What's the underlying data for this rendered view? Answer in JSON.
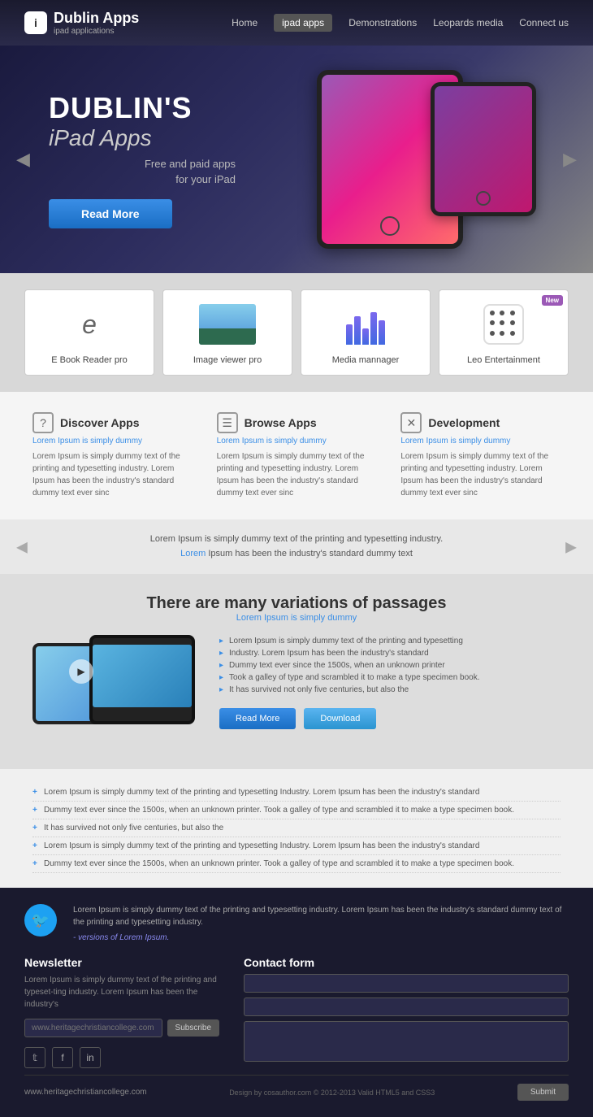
{
  "header": {
    "logo_icon": "i",
    "logo_title": "Dublin Apps",
    "logo_sub": "ipad applications",
    "nav": [
      {
        "label": "Home",
        "active": false
      },
      {
        "label": "ipad apps",
        "active": true
      },
      {
        "label": "Demonstrations",
        "active": false
      },
      {
        "label": "Leopards media",
        "active": false
      },
      {
        "label": "Connect us",
        "active": false
      }
    ]
  },
  "hero": {
    "title_big": "DUBLIN'S",
    "title_sub": "iPad Apps",
    "desc_line1": "Free and paid apps",
    "desc_line2": "for your iPad",
    "btn_label": "Read More",
    "arrow_left": "◀",
    "arrow_right": "▶"
  },
  "apps": [
    {
      "label": "E Book Reader pro",
      "icon_type": "letter"
    },
    {
      "label": "Image viewer pro",
      "icon_type": "landscape"
    },
    {
      "label": "Media mannager",
      "icon_type": "bars"
    },
    {
      "label": "Leo Entertainment",
      "icon_type": "dice",
      "badge": "New"
    }
  ],
  "features": [
    {
      "icon": "?",
      "title": "Discover Apps",
      "sub": "Lorem Ipsum is simply dummy",
      "text": "Lorem Ipsum is simply dummy text of the printing and typesetting industry. Lorem Ipsum has been the industry's standard dummy text ever sinc"
    },
    {
      "icon": "☰",
      "title": "Browse Apps",
      "sub": "Lorem Ipsum is simply dummy",
      "text": "Lorem Ipsum is simply dummy text of the printing and typesetting industry. Lorem Ipsum has been the industry's standard dummy text ever sinc"
    },
    {
      "icon": "✕",
      "title": "Development",
      "sub": "Lorem Ipsum is simply dummy",
      "text": "Lorem Ipsum is simply dummy text of the printing and typesetting industry. Lorem Ipsum has been the industry's standard dummy text ever sinc"
    }
  ],
  "testimonial": {
    "text": "Lorem Ipsum is simply dummy text of the printing and typesetting industry.",
    "text2": "Lorem",
    "text3": "Ipsum has been the industry's standard dummy text"
  },
  "product": {
    "title": "There are many variations of passages",
    "sub": "Lorem Ipsum is simply dummy",
    "bullets": [
      "Lorem Ipsum is simply dummy text of the printing and typesetting",
      "Industry. Lorem Ipsum has been the industry's standard",
      "Dummy text ever since the 1500s, when an unknown printer",
      "Took a galley of type and scrambled it to make a type specimen book.",
      "It has survived not only five centuries, but also the"
    ],
    "btn_read": "Read More",
    "btn_download": "Download"
  },
  "bullets_list": [
    "Lorem Ipsum is simply dummy text of the printing and typesetting Industry. Lorem Ipsum has been the industry's standard",
    "Dummy text ever since the 1500s, when an unknown printer. Took a galley of type and scrambled it to make a type specimen book.",
    "It has survived not only five centuries, but also the",
    "Lorem Ipsum is simply dummy text of the printing and typesetting Industry. Lorem Ipsum has been the industry's standard",
    "Dummy text ever since the 1500s, when an unknown printer. Took a galley of type and scrambled it to make a type specimen book."
  ],
  "footer": {
    "tweet_text": "Lorem Ipsum is simply dummy text of the printing and typesetting industry. Lorem Ipsum has been the industry's standard dummy text  of the printing and typesetting industry.",
    "tweet_italic": "- versions of Lorem Ipsum.",
    "newsletter_title": "Newsletter",
    "newsletter_text": "Lorem Ipsum is simply dummy text of the printing and typeset-ting industry. Lorem Ipsum has been the industry's",
    "newsletter_placeholder": "www.heritagechristiancollege.com",
    "subscribe_label": "Subscribe",
    "contact_title": "Contact form",
    "social_icons": [
      "𝕥",
      "f",
      "in"
    ],
    "submit_label": "Submit",
    "copy_text": "Design by cosauthor.com © 2012-2013  Valid HTML5 and CSS3",
    "url": "www.heritagechristiancollege.com"
  }
}
